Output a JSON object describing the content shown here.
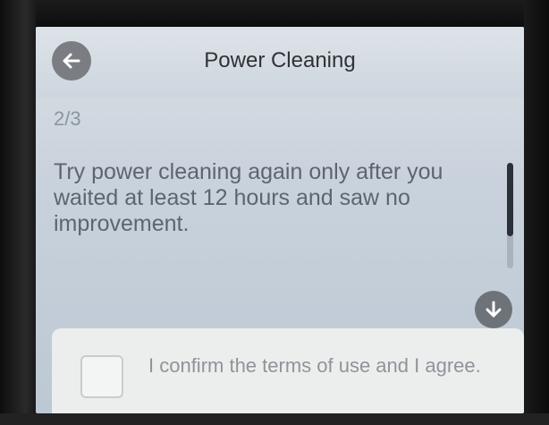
{
  "header": {
    "title": "Power Cleaning",
    "back_icon": "arrow-left-icon"
  },
  "step": {
    "indicator": "2/3"
  },
  "message": {
    "text": "Try power cleaning again only after you waited at least 12 hours and saw no improvement."
  },
  "scroll": {
    "down_icon": "arrow-down-icon"
  },
  "confirm": {
    "label": "I confirm the terms of use and I agree.",
    "checked": false
  },
  "colors": {
    "button_bg": "#7a7d82",
    "screen_bg": "#c9d2dc",
    "text_muted": "#5d6570"
  }
}
